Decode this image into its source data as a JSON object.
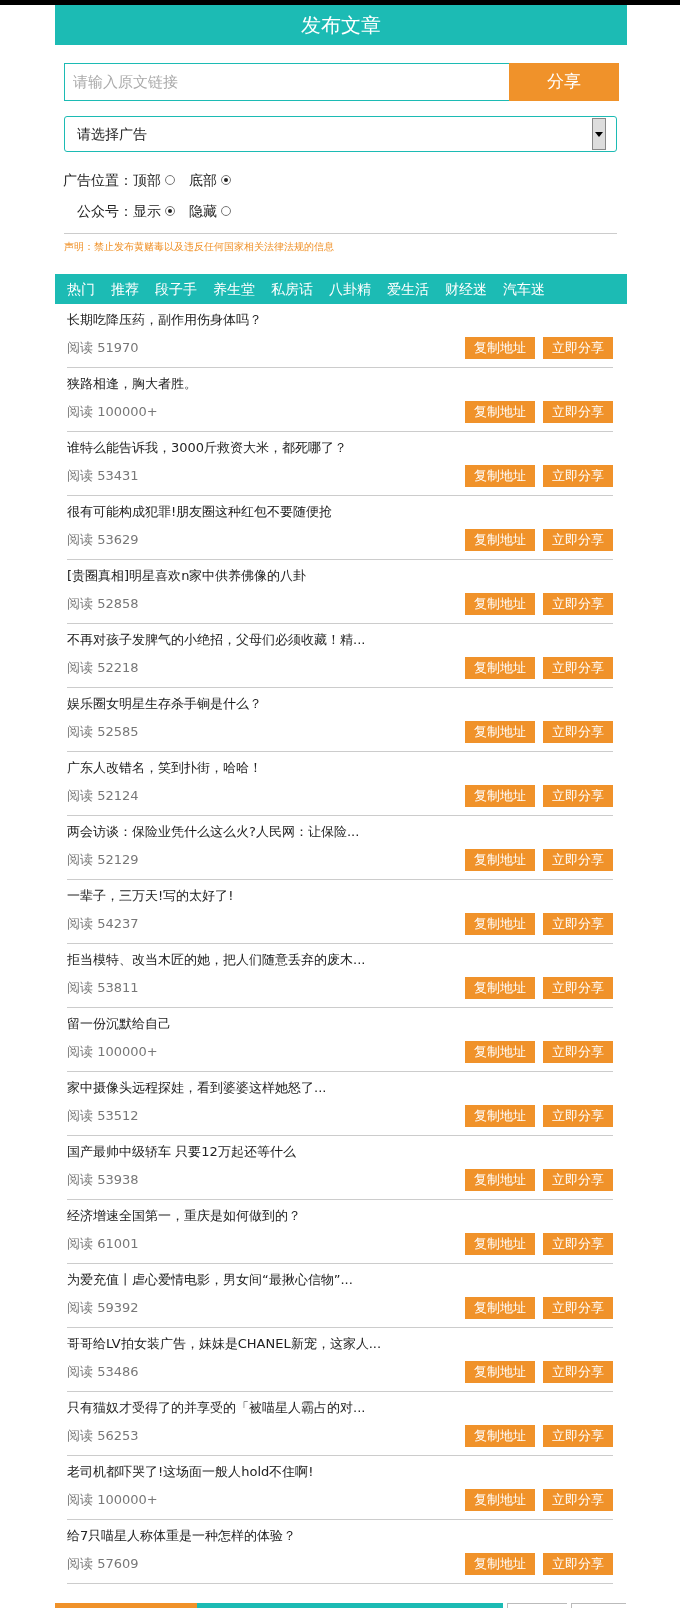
{
  "header": {
    "title": "发布文章"
  },
  "link_form": {
    "placeholder": "请输入原文链接",
    "button": "分享"
  },
  "ad_select": {
    "value": "请选择广告"
  },
  "radio_groups": [
    {
      "label": "广告位置：",
      "options": [
        {
          "label": "顶部",
          "selected": false
        },
        {
          "label": "底部",
          "selected": true
        }
      ]
    },
    {
      "label": "公众号：",
      "options": [
        {
          "label": "显示",
          "selected": true
        },
        {
          "label": "隐藏",
          "selected": false
        }
      ]
    }
  ],
  "notice": "声明：禁止发布黄赌毒以及违反任何国家相关法律法规的信息",
  "tabs": [
    "热门",
    "推荐",
    "段子手",
    "养生堂",
    "私房话",
    "八卦精",
    "爱生活",
    "财经迷",
    "汽车迷"
  ],
  "articles": [
    {
      "title": "长期吃降压药，副作用伤身体吗？",
      "reads": "阅读 51970",
      "copy": "复制地址",
      "share": "立即分享"
    },
    {
      "title": "狭路相逢，胸大者胜。",
      "reads": "阅读 100000+",
      "copy": "复制地址",
      "share": "立即分享"
    },
    {
      "title": "谁特么能告诉我，3000斤救资大米，都死哪了？",
      "reads": "阅读 53431",
      "copy": "复制地址",
      "share": "立即分享"
    },
    {
      "title": "很有可能构成犯罪!朋友圈这种红包不要随便抢",
      "reads": "阅读 53629",
      "copy": "复制地址",
      "share": "立即分享"
    },
    {
      "title": "[贵圈真相]明星喜欢n家中供养佛像的八卦",
      "reads": "阅读 52858",
      "copy": "复制地址",
      "share": "立即分享"
    },
    {
      "title": "不再对孩子发脾气的小绝招，父母们必须收藏！精...",
      "reads": "阅读 52218",
      "copy": "复制地址",
      "share": "立即分享"
    },
    {
      "title": "娱乐圈女明星生存杀手锏是什么？",
      "reads": "阅读 52585",
      "copy": "复制地址",
      "share": "立即分享"
    },
    {
      "title": "广东人改错名，笑到扑街，哈哈！",
      "reads": "阅读 52124",
      "copy": "复制地址",
      "share": "立即分享"
    },
    {
      "title": "两会访谈：保险业凭什么这么火?人民网：让保险...",
      "reads": "阅读 52129",
      "copy": "复制地址",
      "share": "立即分享"
    },
    {
      "title": "一辈子，三万天!写的太好了!",
      "reads": "阅读 54237",
      "copy": "复制地址",
      "share": "立即分享"
    },
    {
      "title": "拒当模特、改当木匠的她，把人们随意丢弃的废木...",
      "reads": "阅读 53811",
      "copy": "复制地址",
      "share": "立即分享"
    },
    {
      "title": "留一份沉默给自己",
      "reads": "阅读 100000+",
      "copy": "复制地址",
      "share": "立即分享"
    },
    {
      "title": "家中摄像头远程探娃，看到婆婆这样她怒了...",
      "reads": "阅读 53512",
      "copy": "复制地址",
      "share": "立即分享"
    },
    {
      "title": "国产最帅中级轿车 只要12万起还等什么",
      "reads": "阅读 53938",
      "copy": "复制地址",
      "share": "立即分享"
    },
    {
      "title": "经济增速全国第一，重庆是如何做到的？",
      "reads": "阅读 61001",
      "copy": "复制地址",
      "share": "立即分享"
    },
    {
      "title": "为爱充值丨虐心爱情电影，男女间“最揪心信物”...",
      "reads": "阅读 59392",
      "copy": "复制地址",
      "share": "立即分享"
    },
    {
      "title": "哥哥给LV拍女装广告，妹妹是CHANEL新宠，这家人...",
      "reads": "阅读 53486",
      "copy": "复制地址",
      "share": "立即分享"
    },
    {
      "title": "只有猫奴才受得了的并享受的「被喵星人霸占的对...",
      "reads": "阅读 56253",
      "copy": "复制地址",
      "share": "立即分享"
    },
    {
      "title": "老司机都吓哭了!这场面一般人hold不住啊!",
      "reads": "阅读 100000+",
      "copy": "复制地址",
      "share": "立即分享"
    },
    {
      "title": "给7只喵星人称体重是一种怎样的体验？",
      "reads": "阅读 57609",
      "copy": "复制地址",
      "share": "立即分享"
    }
  ]
}
